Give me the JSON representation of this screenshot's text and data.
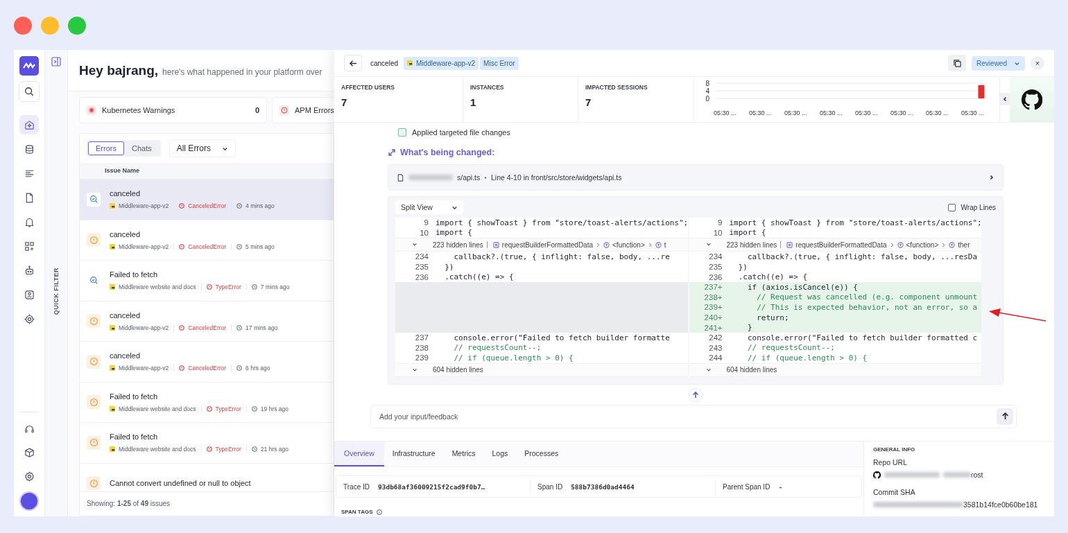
{
  "rail": {
    "items": [
      {
        "kind": "home",
        "selected": true
      },
      {
        "kind": "database",
        "selected": false
      },
      {
        "kind": "list",
        "selected": false
      },
      {
        "kind": "document",
        "selected": false
      },
      {
        "kind": "bell",
        "selected": false
      },
      {
        "kind": "widgets",
        "selected": false
      },
      {
        "kind": "robot",
        "selected": false
      },
      {
        "kind": "person",
        "selected": false
      },
      {
        "kind": "chip",
        "selected": false
      }
    ],
    "bottom_items": [
      {
        "kind": "headset",
        "selected": false
      },
      {
        "kind": "cube",
        "selected": false
      },
      {
        "kind": "settings",
        "selected": false
      }
    ]
  },
  "quick_filter": {
    "label": "QUICK FILTER"
  },
  "dashboard": {
    "greeting": "Hey bajrang,",
    "subtitle": "here's what happened in your platform over",
    "cards": [
      {
        "label": "Kubernetes Warnings",
        "count": "0",
        "kind": "warning"
      },
      {
        "label": "APM Errors",
        "kind": "error"
      }
    ],
    "tabs": [
      {
        "label": "Errors",
        "selected": true
      },
      {
        "label": "Chats",
        "selected": false
      }
    ],
    "filter": {
      "value": "All Errors"
    },
    "column": "Issue Name",
    "issues": [
      {
        "title": "canceled",
        "app": "Middleware-app-v2",
        "error": "CanceledError",
        "time": "4 mins ago",
        "kind": "search",
        "selected": true
      },
      {
        "title": "canceled",
        "app": "Middleware-app-v2",
        "error": "CanceledError",
        "time": "5 mins ago",
        "kind": "alert",
        "selected": false
      },
      {
        "title": "Failed to fetch",
        "app": "Middleware website and docs",
        "error": "TypeError",
        "time": "7 mins ago",
        "kind": "search",
        "selected": false
      },
      {
        "title": "canceled",
        "app": "Middleware-app-v2",
        "error": "CanceledError",
        "time": "17 mins ago",
        "kind": "alert",
        "selected": false
      },
      {
        "title": "canceled",
        "app": "Middleware-app-v2",
        "error": "CanceledError",
        "time": "6 hrs ago",
        "kind": "alert",
        "selected": false
      },
      {
        "title": "Failed to fetch",
        "app": "Middleware website and docs",
        "error": "TypeError",
        "time": "19 hrs ago",
        "kind": "alert",
        "selected": false
      },
      {
        "title": "Failed to fetch",
        "app": "Middleware website and docs",
        "error": "TypeError",
        "time": "21 hrs ago",
        "kind": "alert",
        "selected": false
      },
      {
        "title": "Cannot convert undefined or null to object",
        "kind": "alert",
        "selected": false
      }
    ],
    "footer": "Showing: **1-25** of **49** issues"
  },
  "detail": {
    "title": "canceled",
    "tags": [
      {
        "label": "Middleware-app-v2",
        "kind": "app"
      },
      {
        "label": "Misc Error",
        "kind": "plain"
      }
    ],
    "status": "Reviewed",
    "close": "×",
    "stats": [
      {
        "label": "AFFECTED USERS",
        "value": "7"
      },
      {
        "label": "INSTANCES",
        "value": "1"
      },
      {
        "label": "IMPACTED SESSIONS",
        "value": "7"
      }
    ],
    "chart_data": {
      "type": "bar",
      "categories": [
        "05:30 ...",
        "05:30 ...",
        "05:30 ...",
        "05:30 ...",
        "05:30 ...",
        "05:30 ...",
        "05:30 ...",
        "05:30 ..."
      ],
      "values": [
        0,
        0,
        0,
        0,
        0,
        0,
        0,
        7
      ],
      "ylim": [
        0,
        8
      ],
      "yticks": [
        0,
        4,
        8
      ]
    },
    "step": "Applied targeted file changes",
    "section_title": "What's being changed:",
    "file": {
      "name": "s/api.ts",
      "separator": "•",
      "location": "Line 4-10 in front/src/store/widgets/api.ts"
    },
    "diff": {
      "view": "Split View",
      "wrap": {
        "label": "Wrap Lines",
        "checked": false
      },
      "left": [
        {
          "kind": "code",
          "num": "9",
          "code": "import { showToast } from \"store/toast-alerts/actions\";"
        },
        {
          "kind": "code",
          "num": "10",
          "code": "import {"
        },
        {
          "kind": "hidden",
          "count": "223 hidden lines",
          "crumbs": [
            {
              "label": "requestBuilderFormattedData",
              "kind": "variable"
            },
            {
              "label": "<function>",
              "kind": "function"
            },
            {
              "label": "t",
              "kind": "function"
            }
          ]
        },
        {
          "kind": "code",
          "num": "234",
          "code": "    callback?.(true, { inflight: false, body, ...re"
        },
        {
          "kind": "code",
          "num": "235",
          "code": "  })"
        },
        {
          "kind": "code",
          "num": "236",
          "code": "  .catch((e) => {"
        },
        {
          "kind": "gap"
        },
        {
          "kind": "gap"
        },
        {
          "kind": "gap"
        },
        {
          "kind": "gap"
        },
        {
          "kind": "gap"
        },
        {
          "kind": "code",
          "num": "237",
          "code": "    console.error(\"Failed to fetch builder formatte"
        },
        {
          "kind": "comment",
          "num": "238",
          "code": "    // requestsCount--;"
        },
        {
          "kind": "comment",
          "num": "239",
          "code": "    // if (queue.length > 0) {"
        },
        {
          "kind": "hidden",
          "count": "604 hidden lines"
        }
      ],
      "right": [
        {
          "kind": "code",
          "num": "9",
          "code": "import { showToast } from \"store/toast-alerts/actions\";"
        },
        {
          "kind": "code",
          "num": "10",
          "code": "import {"
        },
        {
          "kind": "hidden",
          "count": "223 hidden lines",
          "crumbs": [
            {
              "label": "requestBuilderFormattedData",
              "kind": "variable"
            },
            {
              "label": "<function>",
              "kind": "function"
            },
            {
              "label": "ther",
              "kind": "function"
            }
          ]
        },
        {
          "kind": "code",
          "num": "234",
          "code": "    callback?.(true, { inflight: false, body, ...resDa"
        },
        {
          "kind": "code",
          "num": "235",
          "code": "  })"
        },
        {
          "kind": "code",
          "num": "236",
          "code": "  .catch((e) => {"
        },
        {
          "kind": "added",
          "num": "237+",
          "code": "    if (axios.isCancel(e)) {"
        },
        {
          "kind": "added_comment",
          "num": "238+",
          "code": "      // Request was cancelled (e.g. component unmount"
        },
        {
          "kind": "added_comment",
          "num": "239+",
          "code": "      // This is expected behavior, not an error, so a"
        },
        {
          "kind": "added",
          "num": "240+",
          "code": "      return;"
        },
        {
          "kind": "added",
          "num": "241+",
          "code": "    }"
        },
        {
          "kind": "code",
          "num": "242",
          "code": "    console.error(\"Failed to fetch builder formatted c"
        },
        {
          "kind": "comment",
          "num": "243",
          "code": "    // requestsCount--;"
        },
        {
          "kind": "comment",
          "num": "244",
          "code": "    // if (queue.length > 0) {"
        },
        {
          "kind": "hidden",
          "count": "604 hidden lines"
        }
      ]
    },
    "feedback": {
      "placeholder": "Add your input/feedback"
    },
    "tabs": [
      {
        "label": "Overview",
        "selected": true
      },
      {
        "label": "Infrastructure",
        "selected": false
      },
      {
        "label": "Metrics",
        "selected": false
      },
      {
        "label": "Logs",
        "selected": false
      },
      {
        "label": "Processes",
        "selected": false
      }
    ],
    "ids": [
      {
        "label": "Trace ID",
        "value": "93db68af36009215f2cad9f0b7…"
      },
      {
        "label": "Span ID",
        "value": "588b7386d0ad4464"
      },
      {
        "label": "Parent Span ID",
        "value": "-"
      }
    ],
    "span_tags": "SPAN TAGS",
    "general_info": {
      "title": "GENERAL INFO",
      "repo_label": "Repo URL",
      "repo_value": "rost",
      "commit_label": "Commit SHA",
      "commit_value": "3581b14fce0b60be181"
    }
  }
}
